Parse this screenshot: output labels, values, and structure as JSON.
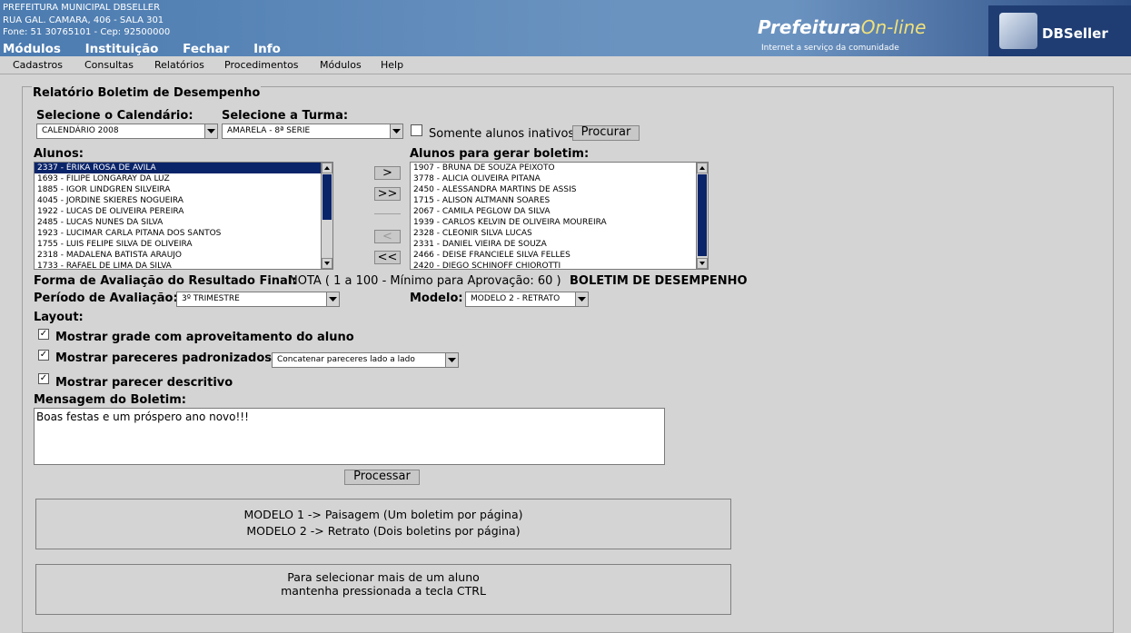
{
  "header": {
    "org_name": "PREFEITURA MUNICIPAL DBSELLER",
    "address": "RUA GAL. CAMARA, 406 - SALA 301",
    "contact": "Fone: 51 30765101  -  Cep: 92500000",
    "brand_main": "Prefeitura",
    "brand_online": "On-line",
    "brand_tagline": "Internet a serviço da comunidade",
    "vendor": "DBSeller"
  },
  "top_menu": [
    "Módulos",
    "Instituição",
    "Fechar",
    "Info"
  ],
  "sub_menu": [
    "Cadastros",
    "Consultas",
    "Relatórios",
    "Procedimentos",
    "Módulos",
    "Help"
  ],
  "form": {
    "legend": "Relatório Boletim de Desempenho",
    "calendar_label": "Selecione o Calendário:",
    "calendar_value": "CALENDÁRIO 2008",
    "class_label": "Selecione a Turma:",
    "class_value": "AMARELA - 8ª SERIE",
    "inactive_label": "Somente alunos inativos",
    "search_button": "Procurar",
    "students_label": "Alunos:",
    "students": [
      "2337 - ÉRIKA ROSA DE AVILA",
      "1693 - FILIPE LONGARAY DA LUZ",
      "1885 - IGOR LINDGREN SILVEIRA",
      "4045 - JORDINE SKIERES NOGUEIRA",
      "1922 - LUCAS DE OLIVEIRA PEREIRA",
      "2485 - LUCAS NUNES DA SILVA",
      "1923 - LUCIMAR CARLA PITANA DOS SANTOS",
      "1755 - LUIS FELIPE SILVA DE OLIVEIRA",
      "2318 - MADALENA BATISTA ARAUJO",
      "1733 - RAFAEL DE LIMA DA SILVA"
    ],
    "selected_student_index": 0,
    "target_label": "Alunos para gerar boletim:",
    "target_students": [
      "1907 - BRUNA DE SOUZA PEIXOTO",
      "3778 - ALICIA OLIVEIRA PITANA",
      "2450 - ALESSANDRA MARTINS DE ASSIS",
      "1715 - ALISON ALTMANN SOARES",
      "2067 - CAMILA PEGLOW DA SILVA",
      "1939 - CARLOS KELVIN DE OLIVEIRA MOUREIRA",
      "2328 - CLEONIR SILVA LUCAS",
      "2331 - DANIEL VIEIRA DE SOUZA",
      "2466 - DEISE FRANCIELE SILVA FELLES",
      "2420 - DIEGO SCHINOFF CHIOROTTI"
    ],
    "move_buttons": [
      ">",
      ">>",
      "<",
      "<<"
    ],
    "evaluation_label": "Forma de Avaliação do Resultado Final:",
    "evaluation_value": "NOTA ( 1 a 100 - Mínimo para Aprovação: 60 )",
    "report_title": "BOLETIM DE DESEMPENHO",
    "period_label": "Período de Avaliação:",
    "period_value": "3º TRIMESTRE",
    "model_label": "Modelo:",
    "model_value": "MODELO 2 - RETRATO",
    "layout_label": "Layout:",
    "opt_grade": "Mostrar grade com aproveitamento do aluno",
    "opt_standard": "Mostrar pareceres padronizados",
    "opt_standard_mode": "Concatenar pareceres lado a lado",
    "opt_descriptive": "Mostrar parecer descritivo",
    "message_label": "Mensagem do Boletim:",
    "message_value": "Boas festas e um próspero ano novo!!!",
    "process_button": "Processar",
    "info_model1": "MODELO 1 -> Paisagem (Um boletim por página)",
    "info_model2": "MODELO 2 -> Retrato (Dois boletins por página)",
    "info_select1": "Para selecionar mais de um aluno",
    "info_select2": "mantenha pressionada a tecla CTRL"
  }
}
